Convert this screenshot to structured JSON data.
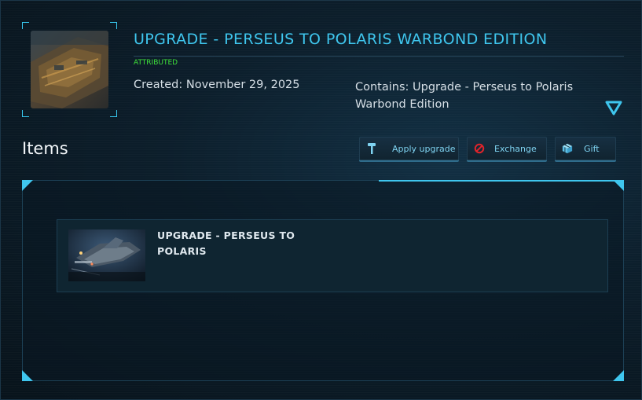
{
  "header": {
    "title": "UPGRADE - PERSEUS TO POLARIS WARBOND EDITION",
    "status": "ATTRIBUTED",
    "created": "Created: November 29, 2025",
    "contains": "Contains: Upgrade - Perseus to Polaris Warbond Edition",
    "thumbnail_icon": "ship-thumbnail-image",
    "expand_icon": "triangle-down-icon"
  },
  "items_section": {
    "heading": "Items",
    "actions": [
      {
        "label": "Apply upgrade",
        "icon": "hammer-icon"
      },
      {
        "label": "Exchange",
        "icon": "prohibited-icon"
      },
      {
        "label": "Gift",
        "icon": "gift-box-icon"
      }
    ],
    "items": [
      {
        "title": "UPGRADE - PERSEUS TO POLARIS",
        "image_icon": "ship-image"
      }
    ]
  },
  "colors": {
    "accent": "#3fc6ee",
    "status_green": "#3fe33a",
    "exchange_red": "#e0242b",
    "background": "#0a1620"
  }
}
